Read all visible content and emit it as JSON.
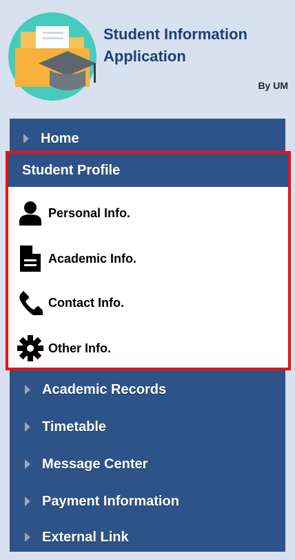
{
  "header": {
    "title_line1": "Student Information",
    "title_line2": "Application",
    "byline": "By UM"
  },
  "nav": {
    "home": "Home",
    "profile": {
      "header": "Student Profile",
      "items": [
        {
          "label": "Personal Info.",
          "icon": "user-icon"
        },
        {
          "label": "Academic Info.",
          "icon": "document-icon"
        },
        {
          "label": "Contact Info.",
          "icon": "phone-icon"
        },
        {
          "label": "Other Info.",
          "icon": "gear-icon"
        }
      ]
    },
    "items": [
      {
        "label": "Academic Records"
      },
      {
        "label": "Timetable"
      },
      {
        "label": "Message Center"
      },
      {
        "label": "Payment Information"
      },
      {
        "label": "External Link"
      }
    ]
  },
  "colors": {
    "background": "#d7e1ef",
    "nav": "#2d5388",
    "highlight_border": "#ee1111",
    "title": "#1e3f73"
  }
}
